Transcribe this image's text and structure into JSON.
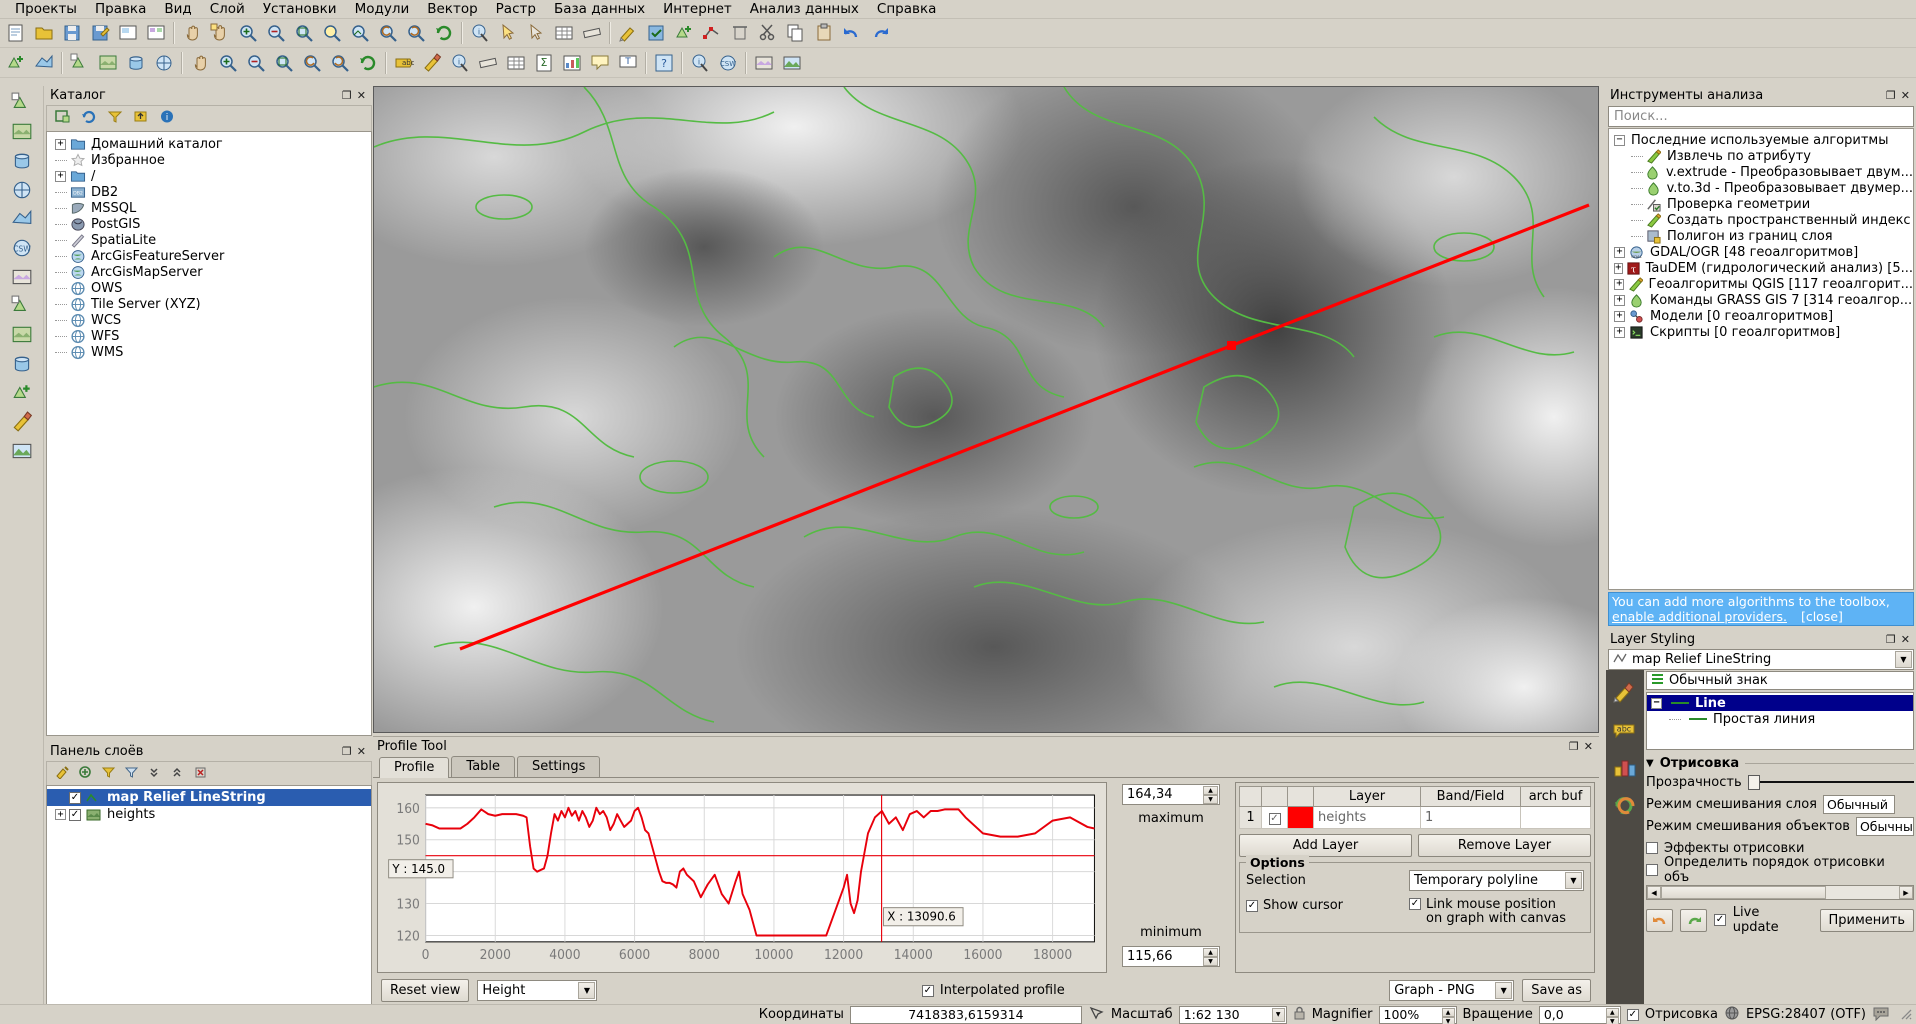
{
  "app": {
    "menu": [
      "Проекты",
      "Правка",
      "Вид",
      "Слой",
      "Установки",
      "Модули",
      "Вектор",
      "Растр",
      "База данных",
      "Интернет",
      "Анализ данных",
      "Справка"
    ]
  },
  "catalog": {
    "title": "Каталог",
    "items": [
      {
        "label": "Домашний каталог",
        "icon": "folder-icon",
        "expand": "+"
      },
      {
        "label": "Избранное",
        "icon": "star-icon",
        "expand": ""
      },
      {
        "label": "/",
        "icon": "folder-icon",
        "expand": "+"
      },
      {
        "label": "DB2",
        "icon": "db2-icon",
        "expand": ""
      },
      {
        "label": "MSSQL",
        "icon": "mssql-icon",
        "expand": ""
      },
      {
        "label": "PostGIS",
        "icon": "postgis-icon",
        "expand": ""
      },
      {
        "label": "SpatiaLite",
        "icon": "spatialite-icon",
        "expand": ""
      },
      {
        "label": "ArcGisFeatureServer",
        "icon": "globe-green-icon",
        "expand": ""
      },
      {
        "label": "ArcGisMapServer",
        "icon": "globe-green-icon",
        "expand": ""
      },
      {
        "label": "OWS",
        "icon": "globe-icon",
        "expand": ""
      },
      {
        "label": "Tile Server (XYZ)",
        "icon": "globe-icon",
        "expand": ""
      },
      {
        "label": "WCS",
        "icon": "globe-icon",
        "expand": ""
      },
      {
        "label": "WFS",
        "icon": "globe-icon",
        "expand": ""
      },
      {
        "label": "WMS",
        "icon": "globe-icon",
        "expand": ""
      }
    ]
  },
  "layers": {
    "title": "Панель слоёв",
    "items": [
      {
        "label": "map Relief LineString",
        "checked": true,
        "selected": true,
        "expand": "",
        "icon": "line-layer-icon"
      },
      {
        "label": "heights",
        "checked": true,
        "selected": false,
        "expand": "+",
        "icon": "raster-layer-icon"
      }
    ]
  },
  "toolbox": {
    "title": "Инструменты анализа",
    "search_placeholder": "Поиск...",
    "root": "Последние используемые алгоритмы",
    "recent": [
      {
        "label": "Извлечь по атрибуту",
        "icon": "qgis-algo-icon"
      },
      {
        "label": "v.extrude - Преобразовывает двум...",
        "icon": "grass-algo-icon"
      },
      {
        "label": "v.to.3d - Преобразовывает двумер...",
        "icon": "grass-algo-icon"
      },
      {
        "label": "Проверка геометрии",
        "icon": "geometry-check-icon"
      },
      {
        "label": "Создать пространственный индекс",
        "icon": "qgis-algo-icon"
      },
      {
        "label": "Полигон из границ слоя",
        "icon": "polygon-icon"
      }
    ],
    "providers": [
      {
        "label": "GDAL/OGR [48 геоалгоритмов]",
        "icon": "gdal-icon"
      },
      {
        "label": "TauDEM (гидрологический анализ) [5...",
        "icon": "taudem-icon"
      },
      {
        "label": "Геоалгоритмы QGIS [117 геоалгорит...",
        "icon": "qgis-algo-icon"
      },
      {
        "label": "Команды GRASS GIS 7 [314 геоалгор...",
        "icon": "grass-algo-icon"
      },
      {
        "label": "Модели [0 геоалгоритмов]",
        "icon": "models-icon"
      },
      {
        "label": "Скрипты [0 геоалгоритмов]",
        "icon": "scripts-icon"
      }
    ],
    "hint_line1": "You can add more algorithms to the toolbox,",
    "hint_link": "enable additional providers.",
    "hint_close": "[close]"
  },
  "styling": {
    "title": "Layer Styling",
    "layer_combo": "map Relief LineString",
    "symbol_header": "Обычный знак",
    "symbol_tree": [
      {
        "label": "Line",
        "selected": true
      },
      {
        "label": "Простая линия",
        "selected": false
      }
    ],
    "render_section": "Отрисовка",
    "transparency_label": "Прозрачность",
    "layer_blend_label": "Режим смешивания слоя",
    "layer_blend_value": "Обычный",
    "feature_blend_label": "Режим смешивания объектов",
    "feature_blend_value": "Обычный",
    "draw_effects_label": "Эффекты отрисовки",
    "draw_effects_checked": false,
    "draw_order_label": "Определить порядок отрисовки объ",
    "draw_order_checked": false,
    "live_update_label": "Live update",
    "live_update_checked": true,
    "apply_label": "Применить"
  },
  "profile": {
    "title": "Profile Tool",
    "tabs": [
      {
        "label": "Profile",
        "active": true
      },
      {
        "label": "Table",
        "active": false
      },
      {
        "label": "Settings",
        "active": false
      }
    ],
    "maximum_label": "maximum",
    "maximum_value": "164,34",
    "minimum_label": "minimum",
    "minimum_value": "115,66",
    "table": {
      "headers": [
        "",
        "",
        "",
        "Layer",
        "Band/Field",
        "arch buf"
      ],
      "rows": [
        {
          "index": "1",
          "checked": true,
          "color": "#ff0000",
          "layer": "heights",
          "band": "1",
          "buffer": ""
        }
      ]
    },
    "add_layer_label": "Add Layer",
    "remove_layer_label": "Remove Layer",
    "options_legend": "Options",
    "selection_label": "Selection",
    "selection_value": "Temporary polyline",
    "show_cursor_label": "Show cursor",
    "show_cursor_checked": true,
    "link_mouse_label_1": "Link mouse position",
    "link_mouse_label_2": "on graph with canvas",
    "link_mouse_checked": true,
    "reset_view_label": "Reset view",
    "units_value": "Height",
    "interpolated_label": "Interpolated profile",
    "interpolated_checked": true,
    "export_format": "Graph - PNG",
    "save_as_label": "Save as"
  },
  "chart_data": {
    "type": "line",
    "title": "",
    "xlabel": "",
    "ylabel": "",
    "xlim": [
      0,
      19200
    ],
    "ylim": [
      118,
      164
    ],
    "xticks": [
      0,
      2000,
      4000,
      6000,
      8000,
      10000,
      12000,
      14000,
      16000,
      18000
    ],
    "yticks": [
      120,
      130,
      140,
      150,
      160
    ],
    "grid": true,
    "legend": "none",
    "line_color": "#e8000b",
    "annotations": [
      {
        "label": "Y : 145.0",
        "axis": "y",
        "value": 145.0
      },
      {
        "label": "X : 13090.6",
        "axis": "x",
        "value": 13090.6
      }
    ],
    "series": [
      {
        "name": "heights",
        "x": [
          0,
          200,
          400,
          600,
          800,
          1000,
          1200,
          1400,
          1600,
          1800,
          2000,
          2200,
          2400,
          2600,
          2800,
          2900,
          3000,
          3100,
          3200,
          3300,
          3400,
          3500,
          3600,
          3700,
          3800,
          3900,
          4000,
          4100,
          4200,
          4300,
          4400,
          4500,
          4600,
          4700,
          4800,
          4900,
          5000,
          5100,
          5200,
          5300,
          5400,
          5500,
          5600,
          5700,
          5800,
          5900,
          6000,
          6100,
          6200,
          6300,
          6400,
          6500,
          6600,
          6700,
          6800,
          6900,
          7000,
          7100,
          7200,
          7300,
          7400,
          7500,
          7700,
          7900,
          8100,
          8300,
          8500,
          8700,
          8900,
          9000,
          9100,
          9300,
          9500,
          9700,
          9800,
          9900,
          10000,
          10500,
          11000,
          11500,
          12000,
          12100,
          12200,
          12300,
          12400,
          12500,
          12700,
          12900,
          13100,
          13300,
          13500,
          13700,
          13900,
          14100,
          14300,
          14500,
          14700,
          14900,
          15100,
          15300,
          15500,
          16000,
          16500,
          17000,
          17500,
          18000,
          18500,
          19000,
          19200
        ],
        "y": [
          155,
          154.5,
          153.5,
          153.5,
          153.5,
          153.5,
          155,
          157,
          159.5,
          158,
          157.5,
          158,
          158,
          158,
          157.5,
          157,
          148,
          141,
          140,
          140.5,
          141,
          145,
          152,
          158,
          156,
          159,
          157,
          160,
          157.5,
          159,
          156,
          159,
          157,
          154,
          156,
          160,
          158,
          159,
          157,
          153,
          155,
          158,
          156,
          154,
          155,
          156,
          159,
          160,
          157,
          153,
          152,
          148,
          144,
          140,
          137,
          136.5,
          136.5,
          136,
          135,
          140,
          141,
          139,
          137,
          132,
          136,
          139,
          133,
          130,
          137,
          140,
          133,
          128,
          120,
          120,
          120,
          120,
          120,
          120,
          120,
          120,
          135,
          139,
          130,
          127,
          131,
          140,
          152,
          157,
          159,
          155,
          157,
          153,
          158,
          159,
          157,
          159,
          159,
          159.5,
          159.5,
          159.5,
          157,
          152,
          151,
          151,
          152,
          156,
          157,
          154,
          153.5
        ]
      }
    ]
  },
  "statusbar": {
    "coordinates_label": "Координаты",
    "coordinates_value": "7418383,6159314",
    "scale_label": "Масштаб",
    "scale_value": "1:62 130",
    "magnifier_label": "Magnifier",
    "magnifier_value": "100%",
    "rotation_label": "Вращение",
    "rotation_value": "0,0",
    "render_label": "Отрисовка",
    "render_checked": true,
    "crs_label": "EPSG:28407 (OTF)"
  },
  "colors": {
    "accent_red": "#e8000b",
    "contour_green": "#55bb44",
    "selection_blue": "#2a5db0",
    "hint_blue": "#5eb3f5"
  }
}
